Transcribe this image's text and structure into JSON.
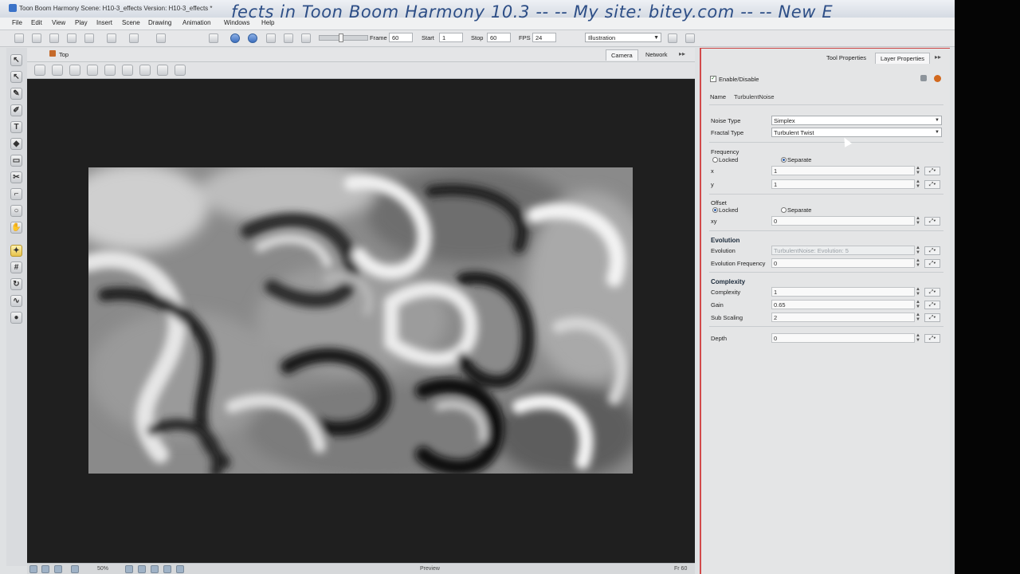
{
  "window": {
    "title": "Toon Boom Harmony Scene: H10-3_effects Version: H10-3_effects *",
    "overlay_text": "fects in Toon Boom Harmony 10.3 -- -- My site: bitey.com -- --    New E"
  },
  "menu": [
    "File",
    "Edit",
    "View",
    "Play",
    "Insert",
    "Scene",
    "Drawing",
    "Animation",
    "Windows",
    "Help"
  ],
  "toolbar": {
    "frame_label": "Frame",
    "frame_value": "60",
    "start_label": "Start",
    "start_value": "1",
    "stop_label": "Stop",
    "stop_value": "60",
    "fps_label": "FPS",
    "fps_value": "24",
    "mode": "Illustration"
  },
  "viewer": {
    "title": "Top",
    "tabs": [
      "Camera",
      "Network"
    ],
    "active_tab": "Camera",
    "zoom": "50%",
    "status_center": "Preview",
    "frame_indicator": "Fr 60"
  },
  "panel": {
    "tabs": [
      "Tool Properties",
      "Layer Properties"
    ],
    "active_tab": "Layer Properties",
    "enable_label": "Enable/Disable",
    "name_label": "Name",
    "name_value": "TurbulentNoise",
    "noise_type_label": "Noise Type",
    "noise_type_value": "Simplex",
    "fractal_type_label": "Fractal Type",
    "fractal_type_value": "Turbulent Twist",
    "frequency_label": "Frequency",
    "locked_label": "Locked",
    "separate_label": "Separate",
    "x_label": "x",
    "x_value": "1",
    "y_label": "y",
    "y_value": "1",
    "offset_label": "Offset",
    "xy_label": "xy",
    "xy_value": "0",
    "evolution_section": "Evolution",
    "evolution_label": "Evolution",
    "evolution_value": "TurbulentNoise: Evolution: 5",
    "evolution_frequency_label": "Evolution Frequency",
    "evolution_frequency_value": "0",
    "complexity_section": "Complexity",
    "complexity_label": "Complexity",
    "complexity_value": "1",
    "gain_label": "Gain",
    "gain_value": "0.65",
    "sub_scaling_label": "Sub Scaling",
    "sub_scaling_value": "2",
    "depth_label": "Depth",
    "depth_value": "0"
  }
}
